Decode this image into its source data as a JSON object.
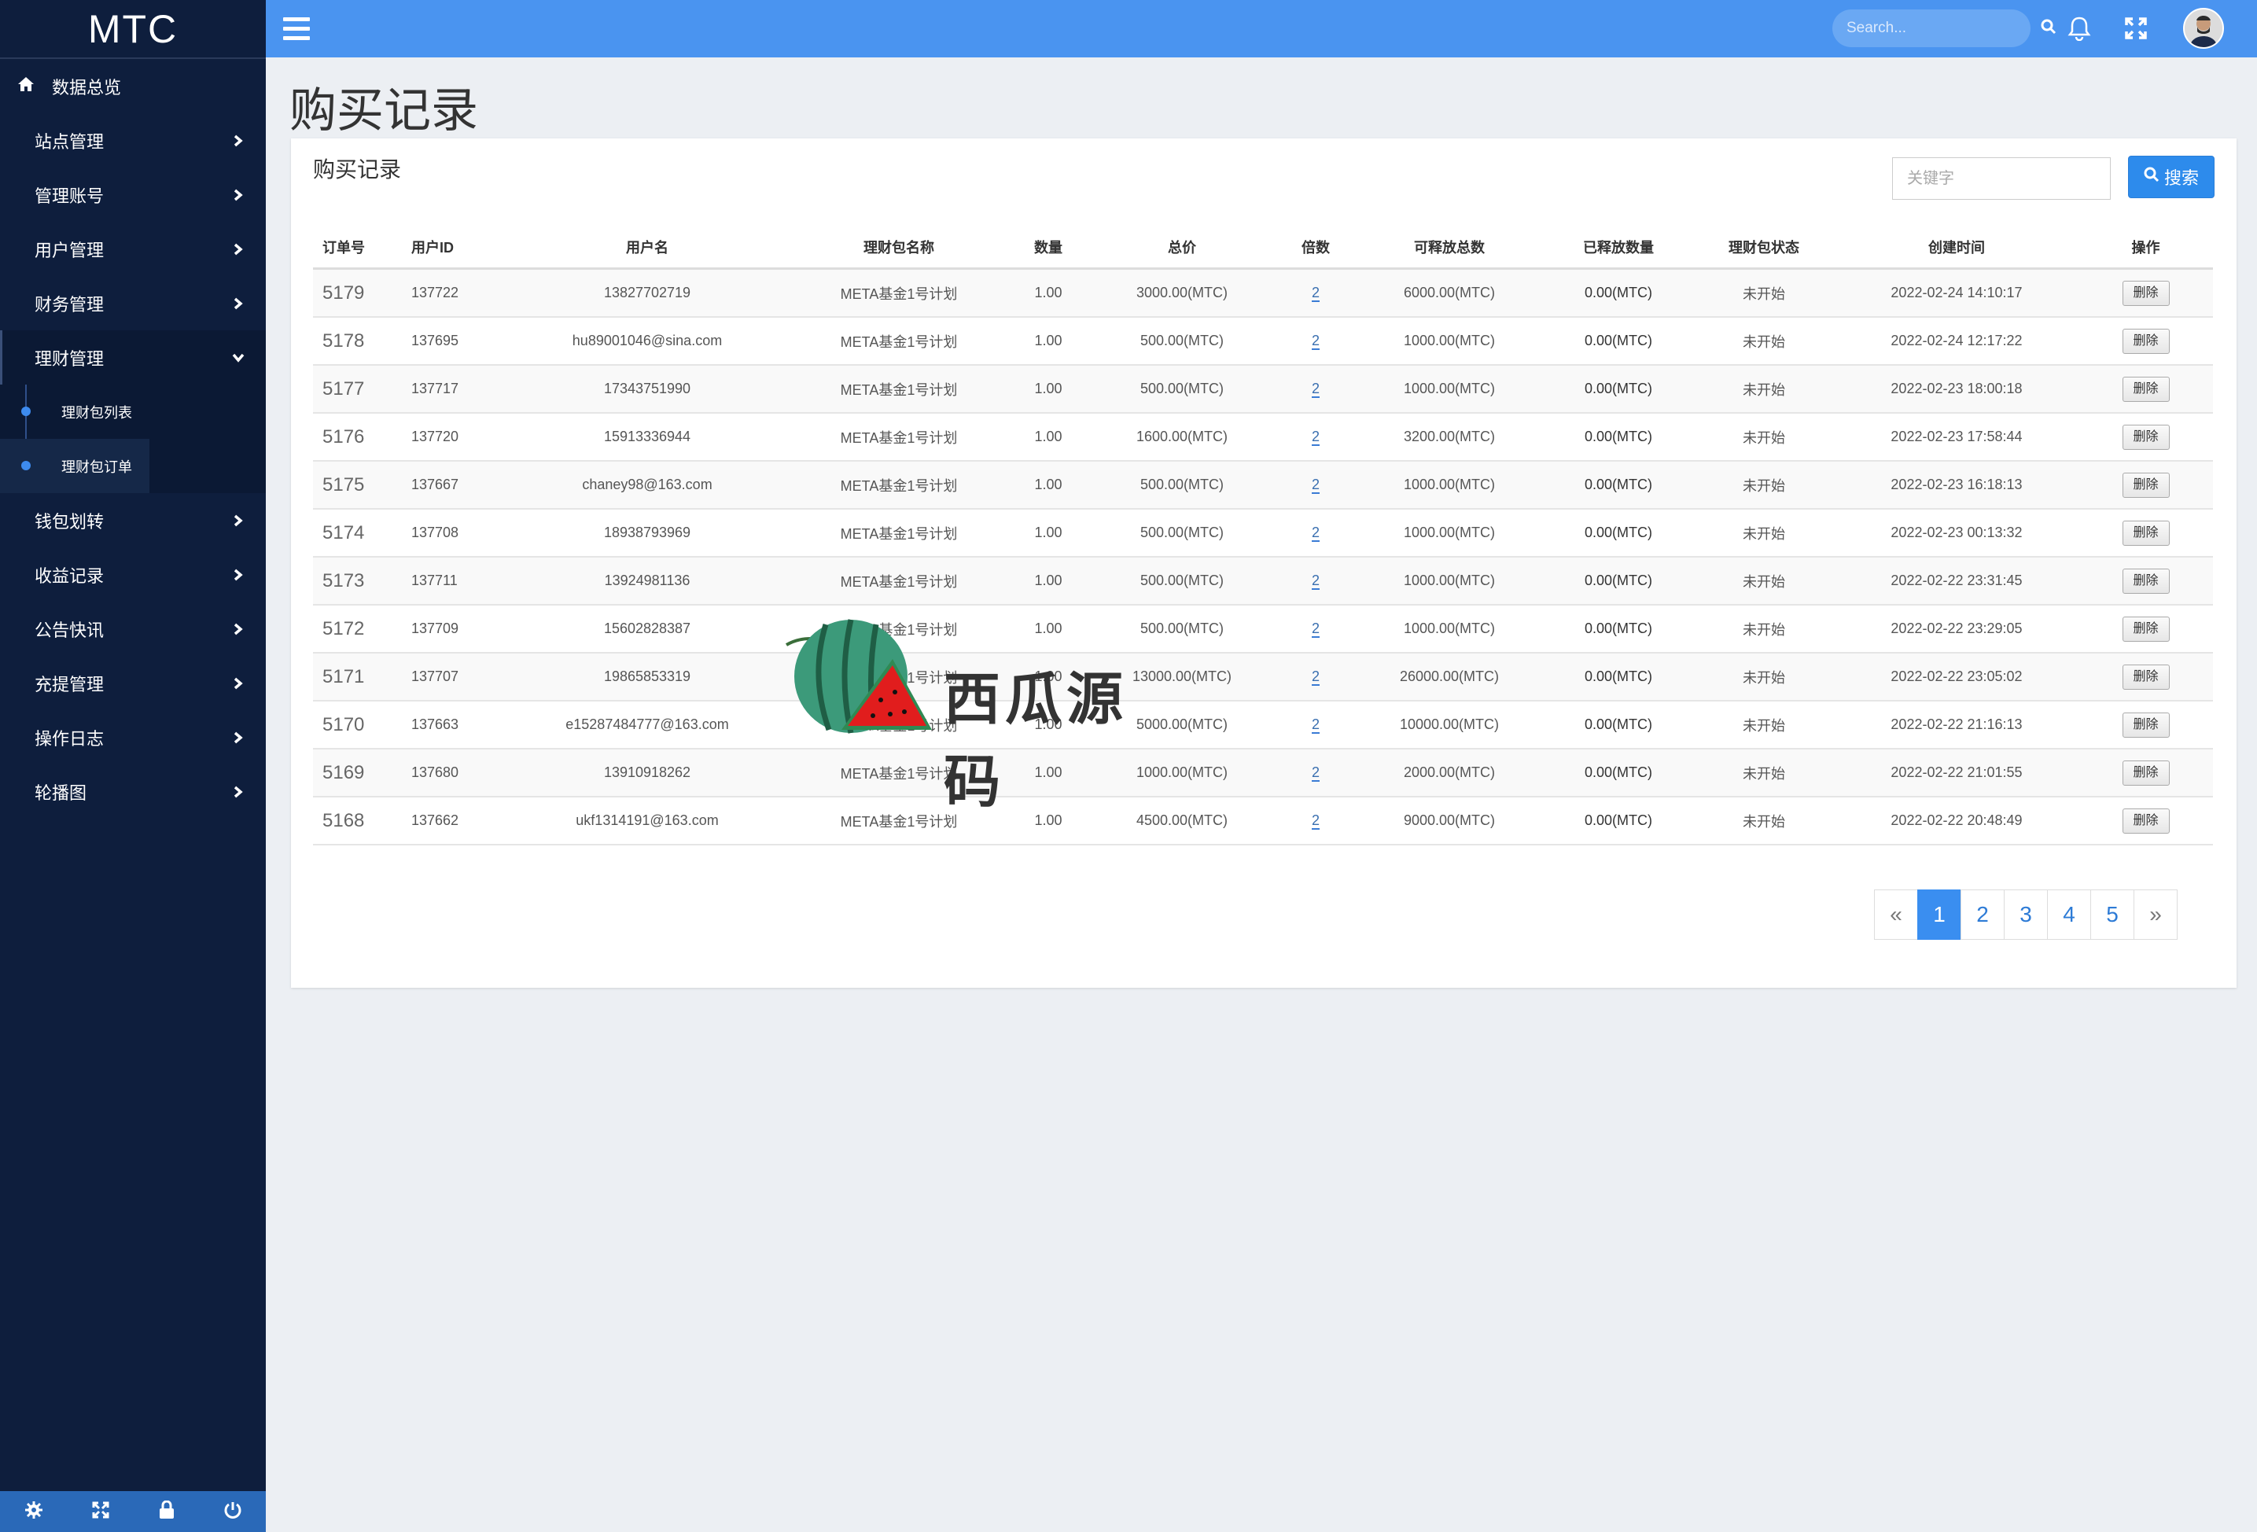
{
  "brand": "MTC",
  "sidebar": {
    "items": [
      {
        "label": "数据总览",
        "icon": "home-icon"
      },
      {
        "label": "站点管理"
      },
      {
        "label": "管理账号"
      },
      {
        "label": "用户管理"
      },
      {
        "label": "财务管理"
      },
      {
        "label": "理财管理",
        "open": true
      },
      {
        "label": "钱包划转"
      },
      {
        "label": "收益记录"
      },
      {
        "label": "公告快讯"
      },
      {
        "label": "充提管理"
      },
      {
        "label": "操作日志"
      },
      {
        "label": "轮播图"
      }
    ],
    "subitems": [
      {
        "label": "理财包列表"
      },
      {
        "label": "理财包订单",
        "active": true
      }
    ],
    "footer_icons": [
      "gear-icon",
      "expand-icon",
      "lock-icon",
      "power-icon"
    ]
  },
  "topbar": {
    "search_placeholder": "Search...",
    "icons": [
      "menu-icon",
      "search-icon",
      "bell-icon",
      "fullscreen-icon",
      "avatar"
    ]
  },
  "page": {
    "title": "购买记录",
    "card_title": "购买记录",
    "keyword_placeholder": "关键字",
    "search_button": "搜索"
  },
  "table": {
    "headers": [
      "订单号",
      "用户ID",
      "用户名",
      "理财包名称",
      "数量",
      "总价",
      "倍数",
      "可释放总数",
      "已释放数量",
      "理财包状态",
      "创建时间",
      "操作"
    ],
    "rows": [
      {
        "id": "5179",
        "uid": "137722",
        "user": "13827702719",
        "pkg": "META基金1号计划",
        "qty": "1.00",
        "total": "3000.00(MTC)",
        "mult": "2",
        "releasable": "6000.00(MTC)",
        "released": "0.00(MTC)",
        "status": "未开始",
        "time": "2022-02-24 14:10:17",
        "action": "删除"
      },
      {
        "id": "5178",
        "uid": "137695",
        "user": "hu89001046@sina.com",
        "pkg": "META基金1号计划",
        "qty": "1.00",
        "total": "500.00(MTC)",
        "mult": "2",
        "releasable": "1000.00(MTC)",
        "released": "0.00(MTC)",
        "status": "未开始",
        "time": "2022-02-24 12:17:22",
        "action": "删除"
      },
      {
        "id": "5177",
        "uid": "137717",
        "user": "17343751990",
        "pkg": "META基金1号计划",
        "qty": "1.00",
        "total": "500.00(MTC)",
        "mult": "2",
        "releasable": "1000.00(MTC)",
        "released": "0.00(MTC)",
        "status": "未开始",
        "time": "2022-02-23 18:00:18",
        "action": "删除"
      },
      {
        "id": "5176",
        "uid": "137720",
        "user": "15913336944",
        "pkg": "META基金1号计划",
        "qty": "1.00",
        "total": "1600.00(MTC)",
        "mult": "2",
        "releasable": "3200.00(MTC)",
        "released": "0.00(MTC)",
        "status": "未开始",
        "time": "2022-02-23 17:58:44",
        "action": "删除"
      },
      {
        "id": "5175",
        "uid": "137667",
        "user": "chaney98@163.com",
        "pkg": "META基金1号计划",
        "qty": "1.00",
        "total": "500.00(MTC)",
        "mult": "2",
        "releasable": "1000.00(MTC)",
        "released": "0.00(MTC)",
        "status": "未开始",
        "time": "2022-02-23 16:18:13",
        "action": "删除"
      },
      {
        "id": "5174",
        "uid": "137708",
        "user": "18938793969",
        "pkg": "META基金1号计划",
        "qty": "1.00",
        "total": "500.00(MTC)",
        "mult": "2",
        "releasable": "1000.00(MTC)",
        "released": "0.00(MTC)",
        "status": "未开始",
        "time": "2022-02-23 00:13:32",
        "action": "删除"
      },
      {
        "id": "5173",
        "uid": "137711",
        "user": "13924981136",
        "pkg": "META基金1号计划",
        "qty": "1.00",
        "total": "500.00(MTC)",
        "mult": "2",
        "releasable": "1000.00(MTC)",
        "released": "0.00(MTC)",
        "status": "未开始",
        "time": "2022-02-22 23:31:45",
        "action": "删除"
      },
      {
        "id": "5172",
        "uid": "137709",
        "user": "15602828387",
        "pkg": "META基金1号计划",
        "qty": "1.00",
        "total": "500.00(MTC)",
        "mult": "2",
        "releasable": "1000.00(MTC)",
        "released": "0.00(MTC)",
        "status": "未开始",
        "time": "2022-02-22 23:29:05",
        "action": "删除"
      },
      {
        "id": "5171",
        "uid": "137707",
        "user": "19865853319",
        "pkg": "META基金1号计划",
        "qty": "1.00",
        "total": "13000.00(MTC)",
        "mult": "2",
        "releasable": "26000.00(MTC)",
        "released": "0.00(MTC)",
        "status": "未开始",
        "time": "2022-02-22 23:05:02",
        "action": "删除"
      },
      {
        "id": "5170",
        "uid": "137663",
        "user": "e15287484777@163.com",
        "pkg": "META基金1号计划",
        "qty": "1.00",
        "total": "5000.00(MTC)",
        "mult": "2",
        "releasable": "10000.00(MTC)",
        "released": "0.00(MTC)",
        "status": "未开始",
        "time": "2022-02-22 21:16:13",
        "action": "删除"
      },
      {
        "id": "5169",
        "uid": "137680",
        "user": "13910918262",
        "pkg": "META基金1号计划",
        "qty": "1.00",
        "total": "1000.00(MTC)",
        "mult": "2",
        "releasable": "2000.00(MTC)",
        "released": "0.00(MTC)",
        "status": "未开始",
        "time": "2022-02-22 21:01:55",
        "action": "删除"
      },
      {
        "id": "5168",
        "uid": "137662",
        "user": "ukf1314191@163.com",
        "pkg": "META基金1号计划",
        "qty": "1.00",
        "total": "4500.00(MTC)",
        "mult": "2",
        "releasable": "9000.00(MTC)",
        "released": "0.00(MTC)",
        "status": "未开始",
        "time": "2022-02-22 20:48:49",
        "action": "删除"
      }
    ]
  },
  "pagination": {
    "prev": "«",
    "pages": [
      "1",
      "2",
      "3",
      "4",
      "5"
    ],
    "active": "1",
    "next": "»"
  },
  "watermark": {
    "text": "西瓜源码"
  }
}
